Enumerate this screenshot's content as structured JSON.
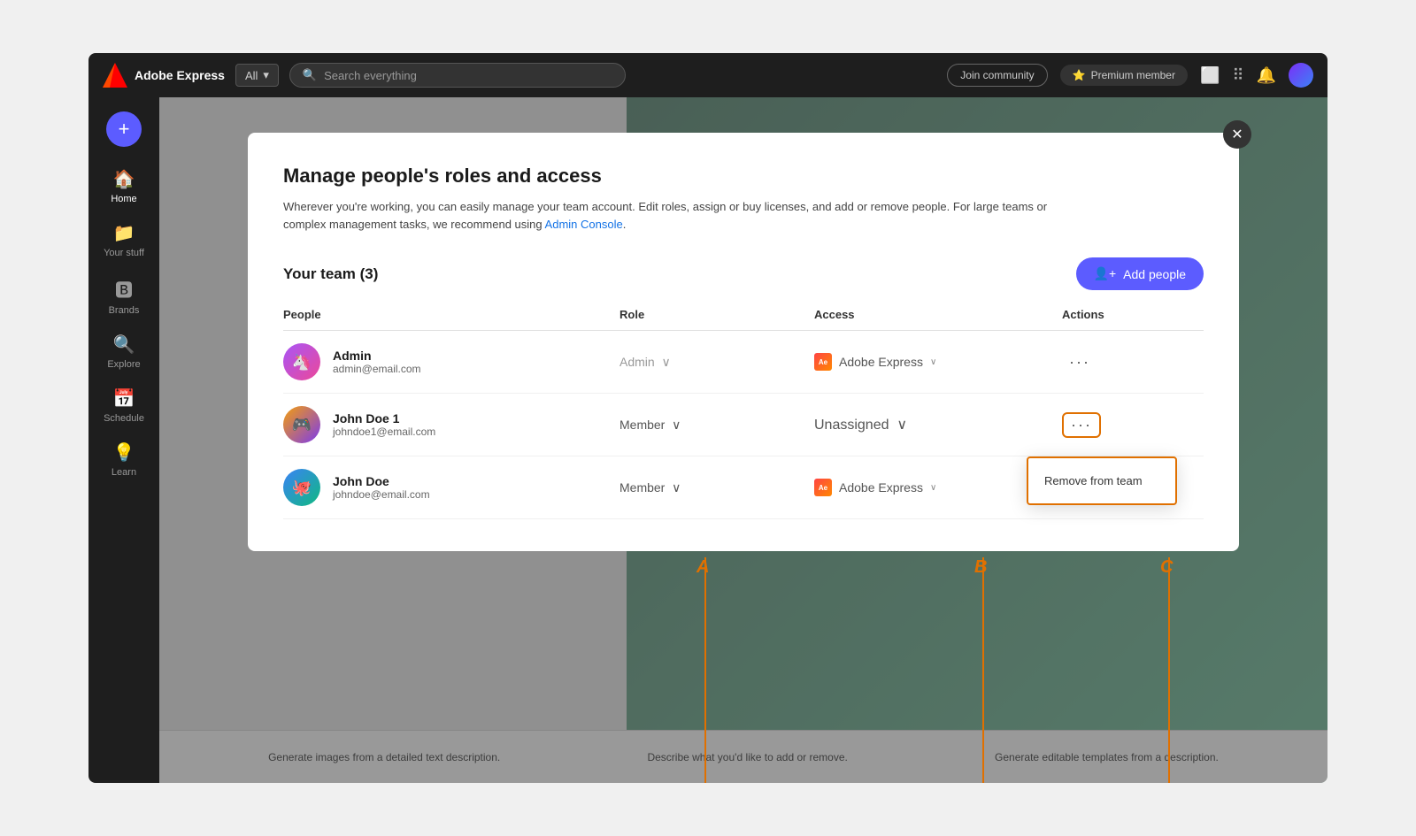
{
  "app": {
    "name": "Adobe Express",
    "topbar": {
      "dropdown_label": "All",
      "search_placeholder": "Search everything",
      "join_community": "Join community",
      "premium_member": "Premium member"
    }
  },
  "sidebar": {
    "add_btn_label": "+",
    "items": [
      {
        "id": "home",
        "label": "Home",
        "icon": "🏠"
      },
      {
        "id": "your-stuff",
        "label": "Your stuff",
        "icon": "📁"
      },
      {
        "id": "brands",
        "label": "Brands",
        "icon": "🅱"
      },
      {
        "id": "explore",
        "label": "Explore",
        "icon": "🔍"
      },
      {
        "id": "schedule",
        "label": "Schedule",
        "icon": "📅"
      },
      {
        "id": "learn",
        "label": "Learn",
        "icon": "💡"
      }
    ]
  },
  "modal": {
    "title": "Manage people's roles and access",
    "description": "Wherever you're working, you can easily manage your team account. Edit roles, assign or buy licenses, and add or remove people. For large teams or complex management tasks, we recommend using",
    "admin_console_link": "Admin Console",
    "team_title": "Your team (3)",
    "add_people_label": "Add people",
    "columns": {
      "people": "People",
      "role": "Role",
      "access": "Access",
      "actions": "Actions"
    },
    "rows": [
      {
        "id": "admin",
        "name": "Admin",
        "email": "admin@email.com",
        "role": "Admin",
        "role_editable": false,
        "access": "Adobe Express",
        "access_icon": "ae",
        "highlighted": false
      },
      {
        "id": "johndoe1",
        "name": "John Doe 1",
        "email": "johndoe1@email.com",
        "role": "Member",
        "role_editable": true,
        "access": "Unassigned",
        "access_icon": null,
        "highlighted": true
      },
      {
        "id": "johndoe",
        "name": "John Doe",
        "email": "johndoe@email.com",
        "role": "Member",
        "role_editable": true,
        "access": "Adobe Express",
        "access_icon": "ae",
        "highlighted": false
      }
    ],
    "dropdown_menu": {
      "remove_from_team": "Remove from team"
    }
  },
  "bottom_bar": {
    "item1": "Generate images from a detailed text description.",
    "item2": "Describe what you'd like to add or remove.",
    "item3": "Generate editable templates from a description."
  },
  "annotations": {
    "a_label": "A",
    "b_label": "B",
    "c_label": "C"
  }
}
